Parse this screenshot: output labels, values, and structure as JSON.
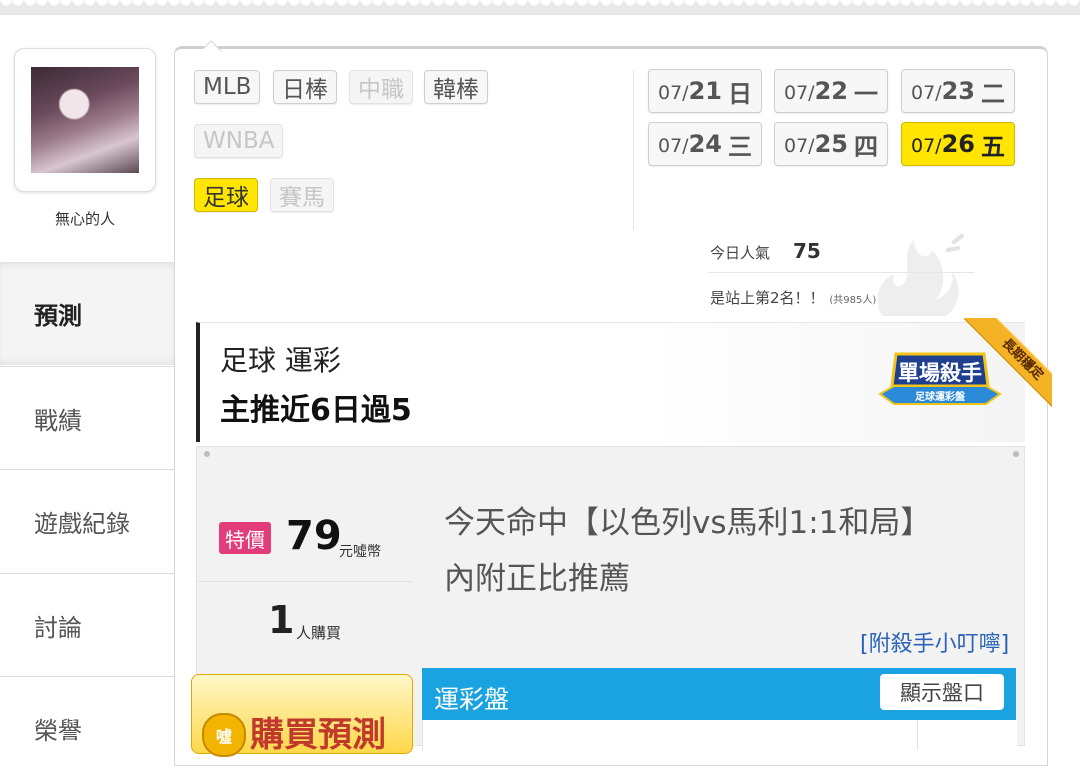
{
  "user": {
    "name": "無心的人"
  },
  "nav": {
    "items": [
      {
        "label": "預測",
        "active": true
      },
      {
        "label": "戰績",
        "active": false
      },
      {
        "label": "遊戲紀錄",
        "active": false
      },
      {
        "label": "討論",
        "active": false
      },
      {
        "label": "榮譽",
        "active": false
      }
    ]
  },
  "sports": [
    {
      "label": "MLB",
      "state": "normal"
    },
    {
      "label": "日棒",
      "state": "normal"
    },
    {
      "label": "中職",
      "state": "disabled"
    },
    {
      "label": "韓棒",
      "state": "normal"
    },
    {
      "label": "WNBA",
      "state": "disabled"
    },
    {
      "label": "足球",
      "state": "selected"
    },
    {
      "label": "賽馬",
      "state": "disabled"
    }
  ],
  "dates": [
    {
      "prefix": "07/",
      "day": "21",
      "weekday": "日",
      "selected": false
    },
    {
      "prefix": "07/",
      "day": "22",
      "weekday": "一",
      "selected": false
    },
    {
      "prefix": "07/",
      "day": "23",
      "weekday": "二",
      "selected": false
    },
    {
      "prefix": "07/",
      "day": "24",
      "weekday": "三",
      "selected": false
    },
    {
      "prefix": "07/",
      "day": "25",
      "weekday": "四",
      "selected": false
    },
    {
      "prefix": "07/",
      "day": "26",
      "weekday": "五",
      "selected": true
    }
  ],
  "popularity": {
    "label": "今日人氣",
    "value": "75",
    "rank_text": "是站上第2名！！",
    "total_text": "(共985人)"
  },
  "headline": {
    "line1": "足球 運彩",
    "line2": "主推近6日過5",
    "badge_title": "單場殺手",
    "badge_sub": "足球運彩盤",
    "ribbon": "長期穩定"
  },
  "offer": {
    "special_label": "特價",
    "price": "79",
    "price_unit": "元噓幣",
    "buyers": "1",
    "buyers_unit": "人購買",
    "desc_line1": "今天命中【以色列vs馬利1:1和局】",
    "desc_line2": "內附正比推薦",
    "tips_link": "[附殺手小叮嚀]",
    "buy_label": "購買預測",
    "coin_label": "噓"
  },
  "odds": {
    "title": "運彩盤",
    "show_button": "顯示盤口"
  },
  "colors": {
    "selected_yellow": "#ffe500",
    "odds_blue": "#1aa3e0",
    "special_pink": "#e23c7a",
    "link_blue": "#2a63b8"
  }
}
